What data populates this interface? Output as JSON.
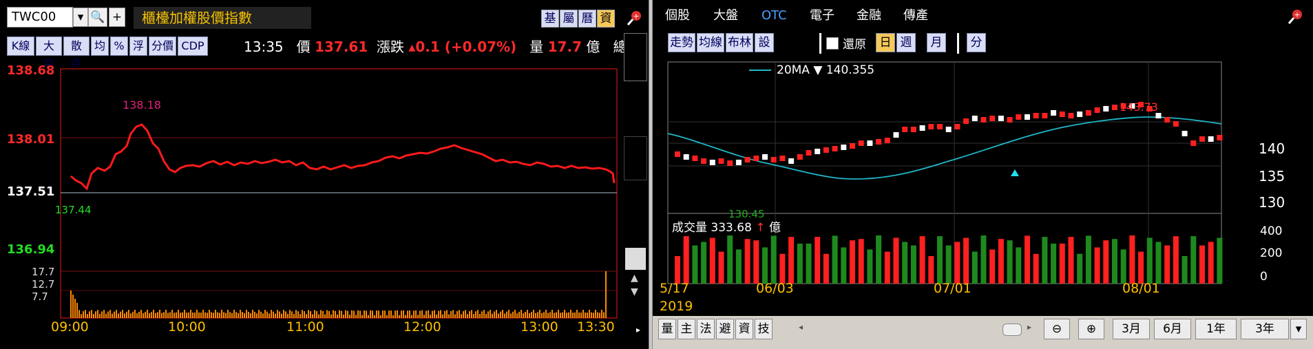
{
  "left": {
    "symbol": "TWC00",
    "index_name": "櫃檯加權股價指數",
    "tag_buttons": [
      "基",
      "屬",
      "曆",
      "資"
    ],
    "tool_buttons": [
      "K線",
      "大戶",
      "散戶",
      "均",
      "%",
      "浮",
      "分價",
      "CDP"
    ],
    "quote": {
      "time": "13:35",
      "price_label": "價",
      "price": "137.61",
      "change_label": "漲跌",
      "change": "▴0.1 (+0.07%)",
      "volume_label": "量",
      "volume": "17.7",
      "volume_unit": "億",
      "total_label": "總量"
    },
    "chart": {
      "type": "line",
      "y_ticks": [
        "138.68",
        "138.01",
        "137.51",
        "136.94"
      ],
      "high_label": "138.18",
      "low_label": "137.44",
      "vol_ticks": [
        "17.7",
        "12.7",
        "7.7"
      ],
      "x_labels": [
        "09:00",
        "10:00",
        "11:00",
        "12:00",
        "13:00",
        "13:30"
      ],
      "colors": {
        "line": "#ff1a1a",
        "up": "#ff2a2a",
        "down": "#22dd22",
        "ref": "#ffffff",
        "axis": "#ffc000"
      }
    }
  },
  "right": {
    "tabs": [
      "個股",
      "大盤",
      "OTC",
      "電子",
      "金融",
      "傳產"
    ],
    "active_tab": "OTC",
    "tool_buttons": [
      "走勢",
      "均線",
      "布林",
      "設"
    ],
    "restore_label": "還原",
    "period_buttons": [
      "日",
      "週",
      "月"
    ],
    "active_period": "日",
    "minute_button": "分",
    "ma_legend": "20MA",
    "ma_value": "140.355",
    "high_label": "143.73",
    "low_label": "130.45",
    "y_ticks": [
      "140",
      "135",
      "130"
    ],
    "volume_legend": "成交量",
    "volume_value": "333.68",
    "volume_unit": "億",
    "vol_ticks": [
      "400",
      "200",
      "0"
    ],
    "x_labels": [
      "5/17",
      "06/03",
      "07/01",
      "08/01"
    ],
    "year_label": "2019",
    "bottom_buttons": [
      "量",
      "主",
      "法",
      "避",
      "資",
      "技"
    ],
    "range_buttons": [
      "3月",
      "6月",
      "1年",
      "3年"
    ]
  },
  "chart_data": [
    {
      "type": "line",
      "title": "櫃檯加權股價指數",
      "categories": [
        "09:00",
        "10:00",
        "11:00",
        "12:00",
        "13:00",
        "13:30"
      ],
      "values": [
        137.66,
        137.72,
        137.75,
        137.84,
        137.77,
        137.61
      ],
      "ylim": [
        136.94,
        138.68
      ],
      "annotations": [
        "138.18",
        "137.44"
      ]
    },
    {
      "type": "bar",
      "title": "OTC",
      "categories": [
        "5/17",
        "06/03",
        "07/01",
        "08/01"
      ],
      "series": [
        {
          "name": "20MA",
          "values": [
            139.5,
            132.6,
            133.5,
            140.355
          ]
        }
      ],
      "ylim": [
        129,
        146
      ]
    }
  ]
}
